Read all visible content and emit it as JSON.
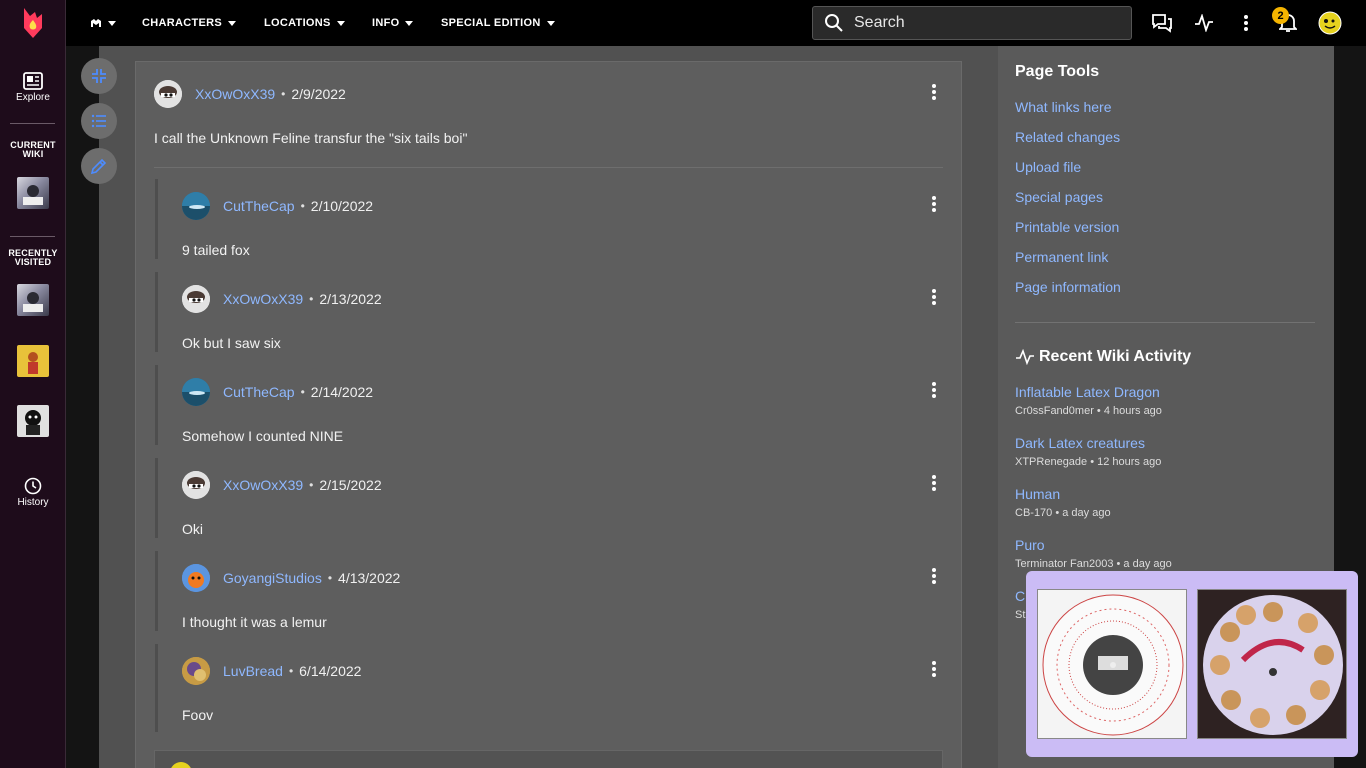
{
  "topnav": {
    "menu": [
      {
        "label": "",
        "icon": "wiki-logo-icon"
      },
      {
        "label": "CHARACTERS"
      },
      {
        "label": "LOCATIONS"
      },
      {
        "label": "INFO"
      },
      {
        "label": "SPECIAL EDITION"
      }
    ],
    "search_placeholder": "Search",
    "notification_count": "2",
    "colors": {
      "bar": "#000000",
      "badge": "#f4b400"
    }
  },
  "global_nav": {
    "explore_label": "Explore",
    "current_wiki_label": "CURRENT WIKI",
    "recently_visited_label": "RECENTLY VISITED",
    "history_label": "History",
    "accent": "#ff3b5c"
  },
  "comments": [
    {
      "user": "XxOwOxX39",
      "date": "2/9/2022",
      "text": "I call the Unknown Feline transfur the \"six tails boi\""
    },
    {
      "user": "CutTheCap",
      "date": "2/10/2022",
      "text": "9 tailed fox"
    },
    {
      "user": "XxOwOxX39",
      "date": "2/13/2022",
      "text": "Ok but I saw six"
    },
    {
      "user": "CutTheCap",
      "date": "2/14/2022",
      "text": "Somehow I counted NINE"
    },
    {
      "user": "XxOwOxX39",
      "date": "2/15/2022",
      "text": "Oki"
    },
    {
      "user": "GoyangiStudios",
      "date": "4/13/2022",
      "text": "I thought it was a lemur"
    },
    {
      "user": "LuvBread",
      "date": "6/14/2022",
      "text": "Foov"
    }
  ],
  "page_tools": {
    "title": "Page Tools",
    "links": [
      "What links here",
      "Related changes",
      "Upload file",
      "Special pages",
      "Printable version",
      "Permanent link",
      "Page information"
    ]
  },
  "recent_activity": {
    "title": "Recent Wiki Activity",
    "items": [
      {
        "title": "Inflatable Latex Dragon",
        "meta": "Cr0ssFand0mer • 4 hours ago"
      },
      {
        "title": "Dark Latex creatures",
        "meta": "XTPRenegade • 12 hours ago"
      },
      {
        "title": "Human",
        "meta": "CB-170 • a day ago"
      },
      {
        "title": "Puro",
        "meta": "Terminator Fan2003 • a day ago"
      },
      {
        "title": "C",
        "meta": "St"
      }
    ]
  },
  "link_color": "#8fb8ff"
}
